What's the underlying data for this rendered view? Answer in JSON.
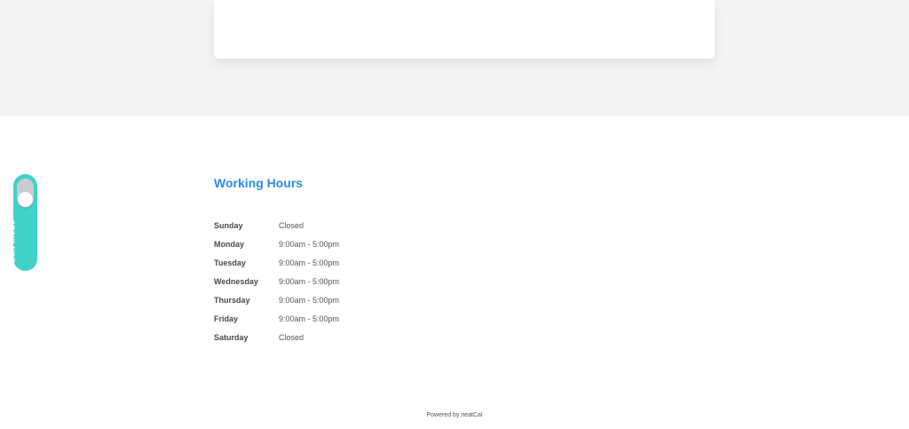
{
  "edit_mode": {
    "label": "Edit mode",
    "enabled": false
  },
  "working_hours": {
    "title": "Working Hours",
    "rows": [
      {
        "day": "Sunday",
        "hours": "Closed"
      },
      {
        "day": "Monday",
        "hours": "9:00am - 5:00pm"
      },
      {
        "day": "Tuesday",
        "hours": "9:00am - 5:00pm"
      },
      {
        "day": "Wednesday",
        "hours": "9:00am - 5:00pm"
      },
      {
        "day": "Thursday",
        "hours": "9:00am - 5:00pm"
      },
      {
        "day": "Friday",
        "hours": "9:00am - 5:00pm"
      },
      {
        "day": "Saturday",
        "hours": "Closed"
      }
    ]
  },
  "footer": {
    "text": "Powered by neatCal"
  },
  "colors": {
    "accent": "#2d8cf0",
    "toggle": "#3fd3c9",
    "band": "#f3f4f6"
  }
}
